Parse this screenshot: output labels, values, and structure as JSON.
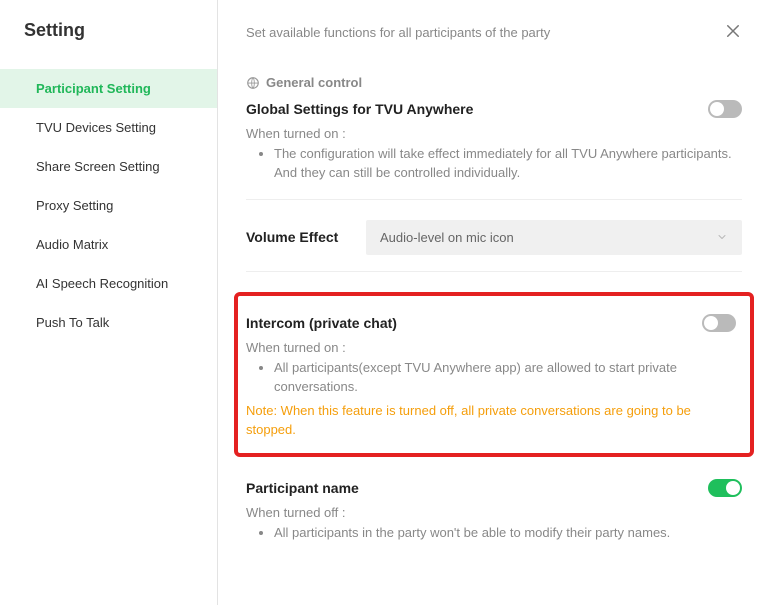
{
  "sidebar": {
    "title": "Setting",
    "items": [
      {
        "label": "Participant Setting"
      },
      {
        "label": "TVU Devices Setting"
      },
      {
        "label": "Share Screen Setting"
      },
      {
        "label": "Proxy Setting"
      },
      {
        "label": "Audio Matrix"
      },
      {
        "label": "AI Speech Recognition"
      },
      {
        "label": "Push To Talk"
      }
    ]
  },
  "main": {
    "subtitle": "Set available functions for all participants of the party",
    "general_label": "General control",
    "global": {
      "title": "Global Settings for TVU Anywhere",
      "when_on": "When turned on :",
      "bullet": "The configuration will take effect immediately for all TVU Anywhere participants. And they can still be controlled individually."
    },
    "volume": {
      "label": "Volume Effect",
      "selected": "Audio-level on mic icon"
    },
    "intercom": {
      "title": "Intercom (private chat)",
      "when_on": "When turned on :",
      "bullet": "All participants(except TVU Anywhere app) are allowed to start private conversations.",
      "note": "Note: When this feature is turned off, all private conversations are going to be stopped."
    },
    "participant_name": {
      "title": "Participant name",
      "when_off": "When turned off :",
      "bullet": "All participants in the party won't be able to modify their party names."
    }
  }
}
